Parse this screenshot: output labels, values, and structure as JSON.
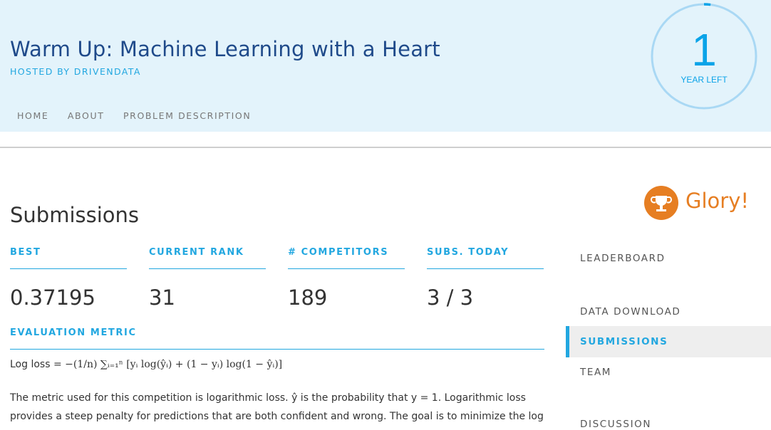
{
  "competition": {
    "title": "Warm Up: Machine Learning with a Heart",
    "hosted_by": "HOSTED BY DRIVENDATA"
  },
  "nav": [
    "HOME",
    "ABOUT",
    "PROBLEM DESCRIPTION"
  ],
  "timer": {
    "value": "1",
    "label": "YEAR LEFT",
    "progress_fraction": 0.02
  },
  "page": {
    "title": "Submissions"
  },
  "stats": [
    {
      "label": "BEST",
      "value": "0.37195"
    },
    {
      "label": "CURRENT RANK",
      "value": "31"
    },
    {
      "label": "# COMPETITORS",
      "value": "189"
    },
    {
      "label": "SUBS. TODAY",
      "value": "3 / 3"
    }
  ],
  "evaluation": {
    "heading": "EVALUATION METRIC",
    "formula_prefix": "Log loss",
    "formula": "= −(1/n) ∑ᵢ₌₁ⁿ [yᵢ log(ŷᵢ) + (1 − yᵢ) log(1 − ŷᵢ)]",
    "description": "The metric used for this competition is logarithmic loss. ŷ is the probability that y = 1. Logarithmic loss provides a steep penalty for predictions that are both confident and wrong. The goal is to minimize the log"
  },
  "prize": {
    "label": "Glory!",
    "icon": "trophy-icon"
  },
  "sidebar": [
    {
      "label": "LEADERBOARD",
      "active": false
    },
    {
      "label": "DATA DOWNLOAD",
      "active": false
    },
    {
      "label": "SUBMISSIONS",
      "active": true
    },
    {
      "label": "TEAM",
      "active": false
    },
    {
      "label": "DISCUSSION",
      "active": false
    }
  ],
  "colors": {
    "accent": "#22a7e0",
    "header_bg": "#e3f3fb",
    "title": "#1f4a8a",
    "prize": "#e67e22"
  }
}
